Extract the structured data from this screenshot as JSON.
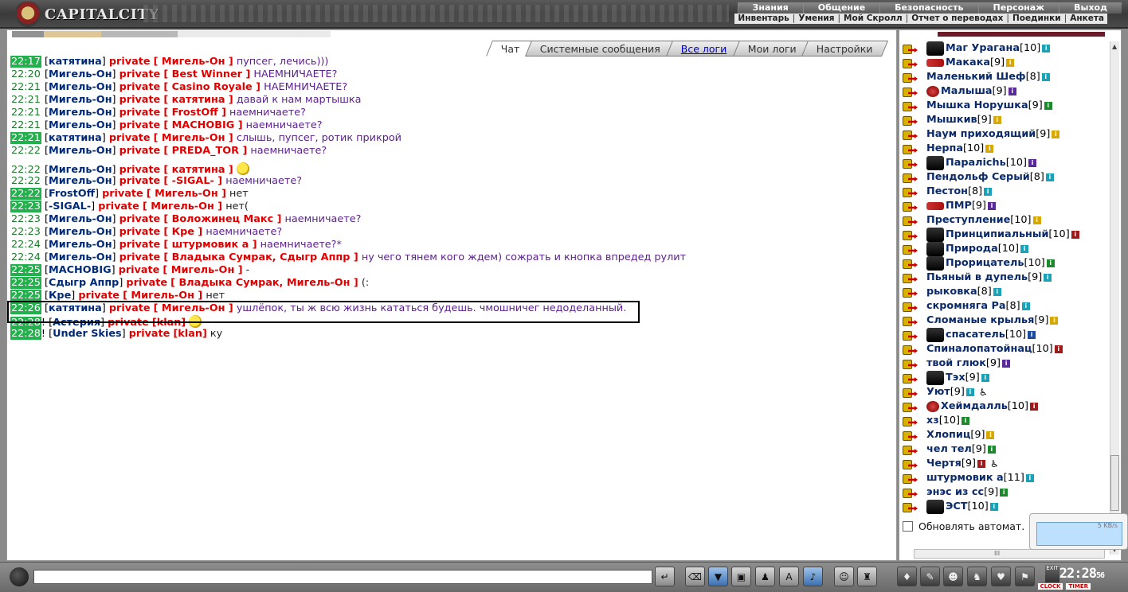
{
  "app": {
    "title": "CAPITALCITY"
  },
  "nav_primary": [
    "Знания",
    "Общение",
    "Безопасность",
    "Персонаж",
    "Выход"
  ],
  "nav_secondary": [
    "Инвентарь",
    "Умения",
    "Мой Скролл",
    "Отчет о переводах",
    "Поединки",
    "Анкета"
  ],
  "tabs": [
    {
      "label": "Чат",
      "active": true
    },
    {
      "label": "Системные сообщения"
    },
    {
      "label": "Все логи",
      "link": true
    },
    {
      "label": "Мои логи"
    },
    {
      "label": "Настройки"
    }
  ],
  "messages": [
    {
      "time": "22:17",
      "green": true,
      "from": "катятина",
      "to": "Мигель-Он",
      "text": "пупсег, лечись)))"
    },
    {
      "time": "22:20",
      "from": "Мигель-Он",
      "to": "Best Winner",
      "text": "НАЕМНИЧАЕТЕ?"
    },
    {
      "time": "22:21",
      "from": "Мигель-Он",
      "to": "Casino Royale",
      "text": "НАЕМНИЧАЕТЕ?"
    },
    {
      "time": "22:21",
      "from": "Мигель-Он",
      "to": "катятина",
      "text": "давай к нам мартышка"
    },
    {
      "time": "22:21",
      "from": "Мигель-Он",
      "to": "FrostOff",
      "text": "наемничаете?"
    },
    {
      "time": "22:21",
      "from": "Мигель-Он",
      "to": "MACHOBIG",
      "text": "наемничаете?"
    },
    {
      "time": "22:21",
      "green": true,
      "from": "катятина",
      "to": "Мигель-Он",
      "text": "слышь, пупсег, ротик прикрой"
    },
    {
      "time": "22:22",
      "from": "Мигель-Он",
      "to": "PREDA_TOR",
      "text": "наемничаете?"
    },
    {
      "time": "22:22",
      "tall": true,
      "from": "Мигель-Он",
      "to": "катятина",
      "text": "",
      "smile": true
    },
    {
      "time": "22:22",
      "from": "Мигель-Он",
      "to": "-SIGAL-",
      "text": "наемничаете?"
    },
    {
      "time": "22:22",
      "green": true,
      "from": "FrostOff",
      "to": "Мигель-Он",
      "text": "нет",
      "dark": true,
      "plainnick": true
    },
    {
      "time": "22:23",
      "green": true,
      "from": "-SIGAL-",
      "to": "Мигель-Он",
      "text": "нет(",
      "dark": true,
      "plainnick": true
    },
    {
      "time": "22:23",
      "from": "Мигель-Он",
      "to": "Воложинец Макс",
      "text": "наемничаете?"
    },
    {
      "time": "22:23",
      "from": "Мигель-Он",
      "to": "Кре",
      "text": "наемничаете?"
    },
    {
      "time": "22:24",
      "from": "Мигель-Он",
      "to": "штурмовик а",
      "text": "наемничаете?*"
    },
    {
      "time": "22:24",
      "from": "Мигель-Он",
      "to": "Владыка Сумрак, Сдыгр Аппр",
      "text": "ну чего тянем кого ждем) сожрать и кнопка впредед рулит"
    },
    {
      "time": "22:25",
      "green": true,
      "from": "MACHOBIG",
      "to": "Мигель-Он",
      "text": "-",
      "dark": true,
      "plainnick": true
    },
    {
      "time": "22:25",
      "green": true,
      "from": "Сдыгр Аппр",
      "to": "Владыка Сумрак, Мигель-Он",
      "text": "(:",
      "dark": true,
      "plainnick": true
    },
    {
      "time": "22:25",
      "green": true,
      "from": "Кре",
      "to": "Мигель-Он",
      "text": "нет",
      "dark": true,
      "plainnick": true
    },
    {
      "time": "22:26",
      "green": true,
      "from": "катятина",
      "to": "Мигель-Он",
      "text": "ушлёпок, ты ж всю жизнь кататься будешь. чмошничег недоделанный."
    },
    {
      "time": "22:28",
      "green": true,
      "excl": true,
      "from": "Астерия",
      "to": "klan",
      "text": "",
      "smile": true,
      "brackets": "square"
    },
    {
      "time": "22:28",
      "green": true,
      "excl": true,
      "from": "Under Skies",
      "to": "klan",
      "text": "ку",
      "dark": true,
      "brackets": "square"
    }
  ],
  "labels": {
    "private": "private"
  },
  "users": [
    {
      "name": "Маг Урагана",
      "lvl": "[10]",
      "i": "teal",
      "badge": "spider"
    },
    {
      "name": "Макака",
      "lvl": "[9]",
      "i": "gold",
      "badge": "red"
    },
    {
      "name": "Маленький Шеф",
      "lvl": "[8]",
      "i": "teal"
    },
    {
      "name": "Малыша",
      "lvl": "[9]",
      "i": "purple",
      "badge": "sm"
    },
    {
      "name": "Мышка Норушка",
      "lvl": "[9]",
      "i": "green"
    },
    {
      "name": "Мышкив",
      "lvl": "[9]",
      "i": "gold"
    },
    {
      "name": "Наум приходящий",
      "lvl": "[9]",
      "i": "gold"
    },
    {
      "name": "Нерпа",
      "lvl": "[10]",
      "i": "gold"
    },
    {
      "name": "Паралichь",
      "lvl": "[10]",
      "i": "purple",
      "badge": "flag"
    },
    {
      "name": "Пендольф Серый",
      "lvl": "[8]",
      "i": "teal"
    },
    {
      "name": "Пестон",
      "lvl": "[8]",
      "i": "teal"
    },
    {
      "name": "ПМР",
      "lvl": "[9]",
      "i": "purple",
      "badge": "flag2"
    },
    {
      "name": "Преступление",
      "lvl": "[10]",
      "i": "gold"
    },
    {
      "name": "Принципиальный",
      "lvl": "[10]",
      "i": "red",
      "badge": "skull"
    },
    {
      "name": "Природа",
      "lvl": "[10]",
      "i": "teal",
      "badge": "fire"
    },
    {
      "name": "Прорицатель",
      "lvl": "[10]",
      "i": "green",
      "badge": "bat"
    },
    {
      "name": "Пьяный в дупель",
      "lvl": "[9]",
      "i": "teal"
    },
    {
      "name": "рыковка",
      "lvl": "[8]",
      "i": "teal"
    },
    {
      "name": "скромняга Ра",
      "lvl": "[8]",
      "i": "teal"
    },
    {
      "name": "Сломаные крылья",
      "lvl": "[9]",
      "i": "gold"
    },
    {
      "name": "спасатель",
      "lvl": "[10]",
      "i": "blue",
      "badge": "star"
    },
    {
      "name": "Спиналопатойнац",
      "lvl": "[10]",
      "i": "red"
    },
    {
      "name": "твой глюк",
      "lvl": "[9]",
      "i": "purple"
    },
    {
      "name": "Тэх",
      "lvl": "[9]",
      "i": "teal",
      "badge": "mk"
    },
    {
      "name": "Уют",
      "lvl": "[9]",
      "i": "teal",
      "wheel": true
    },
    {
      "name": "Хеймдалль",
      "lvl": "[10]",
      "i": "red",
      "badge": "sm"
    },
    {
      "name": "хз",
      "lvl": "[10]",
      "i": "green"
    },
    {
      "name": "Хлопиц",
      "lvl": "[9]",
      "i": "gold"
    },
    {
      "name": "чел тел",
      "lvl": "[9]",
      "i": "green"
    },
    {
      "name": "Чертя",
      "lvl": "[9]",
      "i": "red",
      "wheel": true
    },
    {
      "name": "штурмовик а",
      "lvl": "[11]",
      "i": "teal"
    },
    {
      "name": "энэс из сс",
      "lvl": "[9]",
      "i": "green"
    },
    {
      "name": "ЭСТ",
      "lvl": "[10]",
      "i": "teal",
      "badge": "gun"
    }
  ],
  "auto_refresh_label": "Обновлять автомат.",
  "net_speed": "5 KB/s",
  "chat_input": {
    "value": ""
  },
  "clock": {
    "time": "22:28",
    "seconds": "56",
    "label_clock": "CLOCK",
    "label_timer": "TIMER"
  },
  "exit_label": "EXIT",
  "colors": {
    "time_green": "#22b14c",
    "private": "#e00000",
    "nick": "#002a78",
    "text": "#5a1f8c"
  }
}
